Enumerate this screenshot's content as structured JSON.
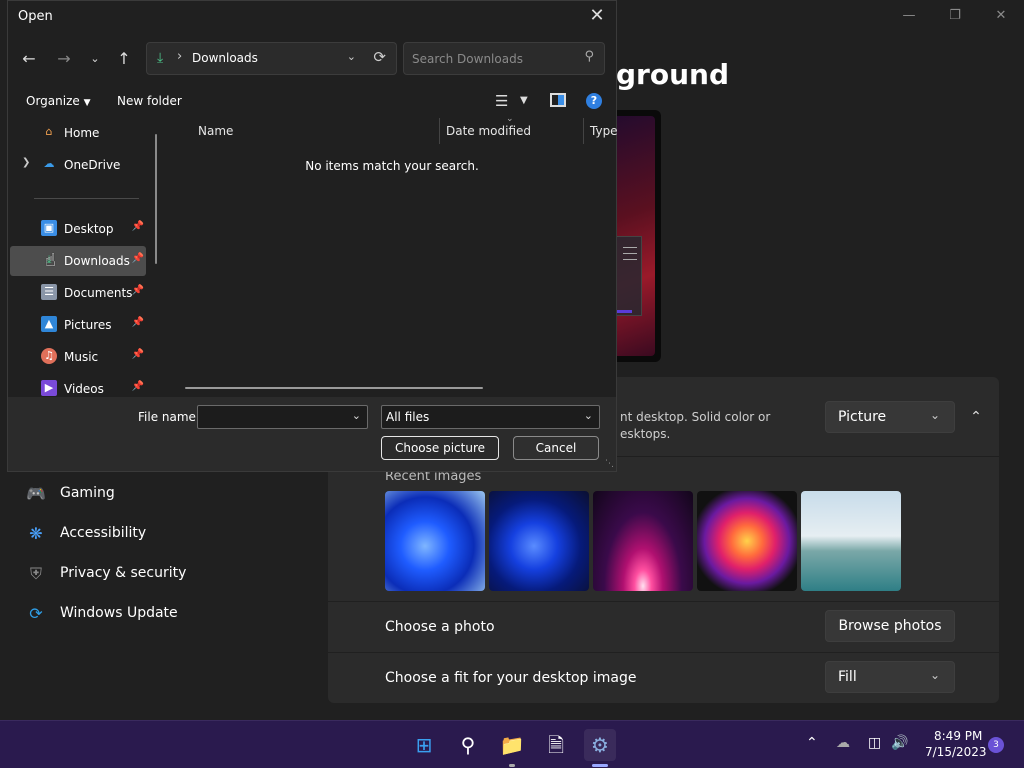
{
  "settings": {
    "page_heading": "ground",
    "bg_description_line1": "nt desktop. Solid color or",
    "bg_description_line2": "esktops.",
    "bg_type_value": "Picture",
    "recent_images_label": "Recent images",
    "choose_photo_label": "Choose a photo",
    "browse_photos_label": "Browse photos",
    "fit_label": "Choose a fit for your desktop image",
    "fit_value": "Fill",
    "nav": [
      {
        "label": "Gaming",
        "icon": "gamepad-icon"
      },
      {
        "label": "Accessibility",
        "icon": "accessibility-icon"
      },
      {
        "label": "Privacy & security",
        "icon": "shield-icon"
      },
      {
        "label": "Windows Update",
        "icon": "update-icon"
      }
    ]
  },
  "dialog": {
    "title": "Open",
    "address_path": "Downloads",
    "search_placeholder": "Search Downloads",
    "organize_label": "Organize",
    "new_folder_label": "New folder",
    "nav_pane": [
      {
        "label": "Home",
        "icon": "home-icon",
        "pinned": false
      },
      {
        "label": "OneDrive",
        "icon": "onedrive-icon",
        "pinned": false
      },
      {
        "label": "Desktop",
        "icon": "desktop-icon",
        "pinned": true
      },
      {
        "label": "Downloads",
        "icon": "downloads-icon",
        "pinned": true,
        "selected": true
      },
      {
        "label": "Documents",
        "icon": "documents-icon",
        "pinned": true
      },
      {
        "label": "Pictures",
        "icon": "pictures-icon",
        "pinned": true
      },
      {
        "label": "Music",
        "icon": "music-icon",
        "pinned": true
      },
      {
        "label": "Videos",
        "icon": "videos-icon",
        "pinned": true
      }
    ],
    "columns": [
      "Name",
      "Date modified",
      "Type"
    ],
    "empty_message": "No items match your search.",
    "file_name_label": "File name:",
    "file_name_value": "",
    "file_type_value": "All files",
    "choose_button": "Choose picture",
    "cancel_button": "Cancel"
  },
  "taskbar": {
    "time": "8:49 PM",
    "date": "7/15/2023",
    "notification_count": "3"
  },
  "colors": {
    "accent": "#2f7fe0",
    "taskbar": "#2a1a4e",
    "selection": "#4d4d4d"
  }
}
